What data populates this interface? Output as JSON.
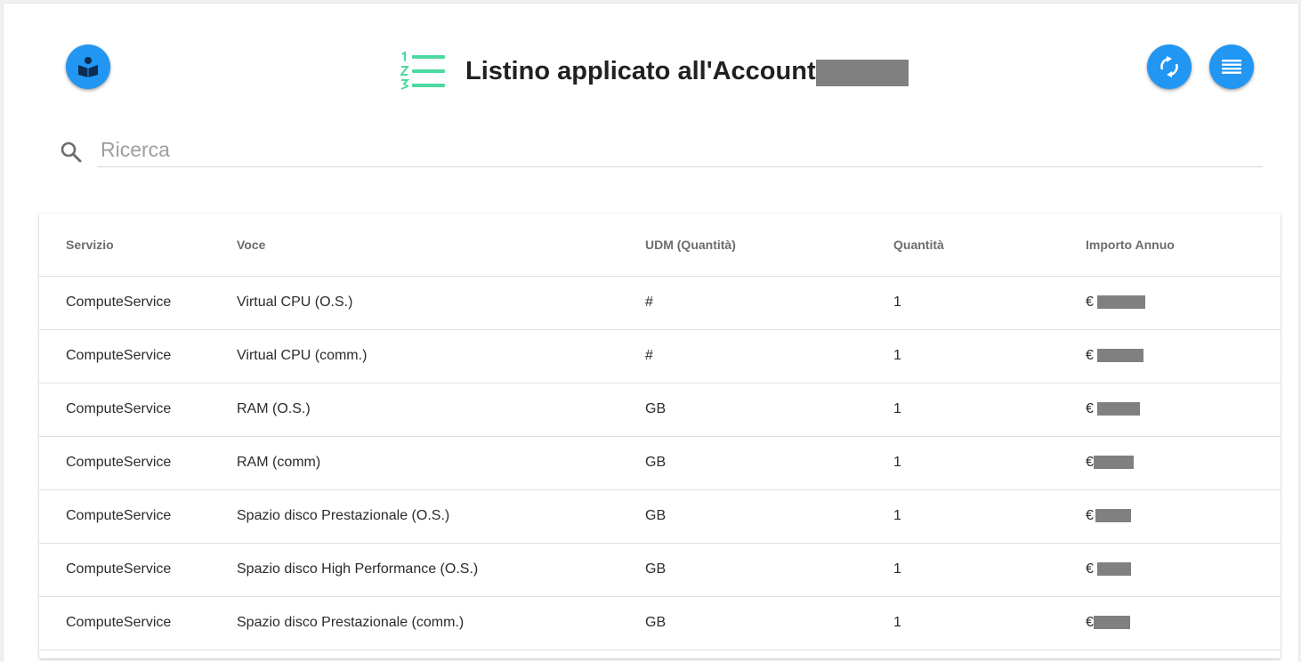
{
  "header": {
    "title": "Listino applicato all'Account",
    "title_icon": "numbered-list-icon",
    "left_button_icon": "reader-book-icon",
    "refresh_button_icon": "refresh-icon",
    "menu_button_icon": "list-icon"
  },
  "search": {
    "placeholder": "Ricerca",
    "value": ""
  },
  "table": {
    "columns": [
      "Servizio",
      "Voce",
      "UDM (Quantità)",
      "Quantità",
      "Importo Annuo"
    ],
    "rows": [
      {
        "servizio": "ComputeService",
        "voce": "Virtual CPU (O.S.)",
        "udm": "#",
        "quantita": "1",
        "currency": "€"
      },
      {
        "servizio": "ComputeService",
        "voce": "Virtual CPU (comm.)",
        "udm": "#",
        "quantita": "1",
        "currency": "€"
      },
      {
        "servizio": "ComputeService",
        "voce": "RAM (O.S.)",
        "udm": "GB",
        "quantita": "1",
        "currency": "€"
      },
      {
        "servizio": "ComputeService",
        "voce": "RAM (comm)",
        "udm": "GB",
        "quantita": "1",
        "currency": "€"
      },
      {
        "servizio": "ComputeService",
        "voce": "Spazio disco Prestazionale (O.S.)",
        "udm": "GB",
        "quantita": "1",
        "currency": "€"
      },
      {
        "servizio": "ComputeService",
        "voce": "Spazio disco High Performance (O.S.)",
        "udm": "GB",
        "quantita": "1",
        "currency": "€"
      },
      {
        "servizio": "ComputeService",
        "voce": "Spazio disco Prestazionale (comm.)",
        "udm": "GB",
        "quantita": "1",
        "currency": "€"
      }
    ]
  },
  "colors": {
    "accent": "#2196f3",
    "title_icon": "#4cd9a0",
    "redaction": "#808080"
  }
}
